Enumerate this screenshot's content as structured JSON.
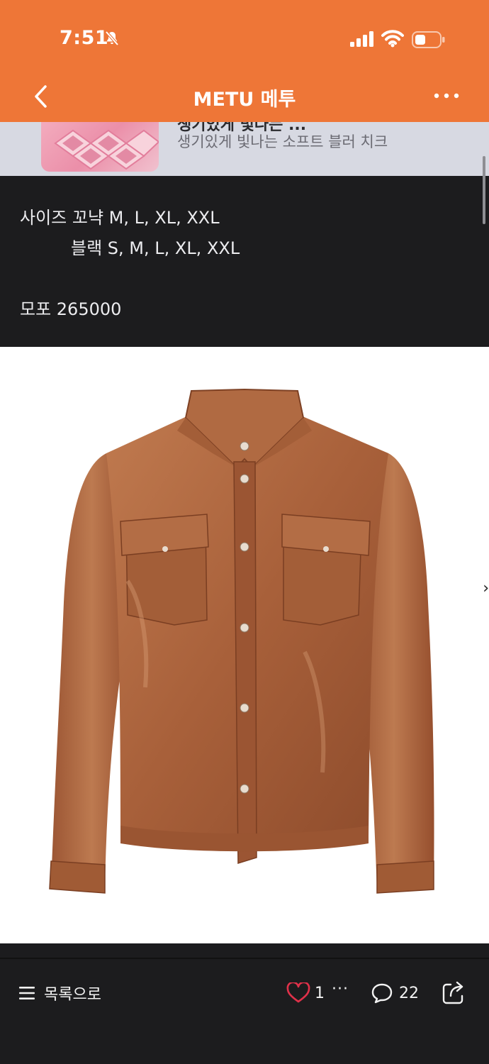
{
  "status_bar": {
    "time": "7:51"
  },
  "nav": {
    "title": "METU 메투"
  },
  "ad": {
    "cut_text": "생기있게 빛나는 ...",
    "subtitle": "생기있게 빛나는 소프트 블러 치크"
  },
  "post": {
    "lines": [
      "사이즈 꼬냑 M, L, XL, XXL",
      "블랙 S, M, L, XL, XXL",
      "모포 265000"
    ]
  },
  "image": {
    "alt": "cognac leather shirt jacket",
    "next_glyph": "›"
  },
  "bottom_bar": {
    "list_label": "목록으로",
    "like_count": "1",
    "more_dots": "···",
    "comment_count": "22"
  },
  "colors": {
    "header": "#ee7637",
    "like": "#e0314a",
    "background": "#1c1c1e"
  },
  "icons": [
    "bell-slash-icon",
    "signal-icon",
    "wifi-icon",
    "battery-icon",
    "back-chevron-icon",
    "more-icon",
    "menu-icon",
    "heart-icon",
    "comment-icon",
    "share-icon"
  ]
}
